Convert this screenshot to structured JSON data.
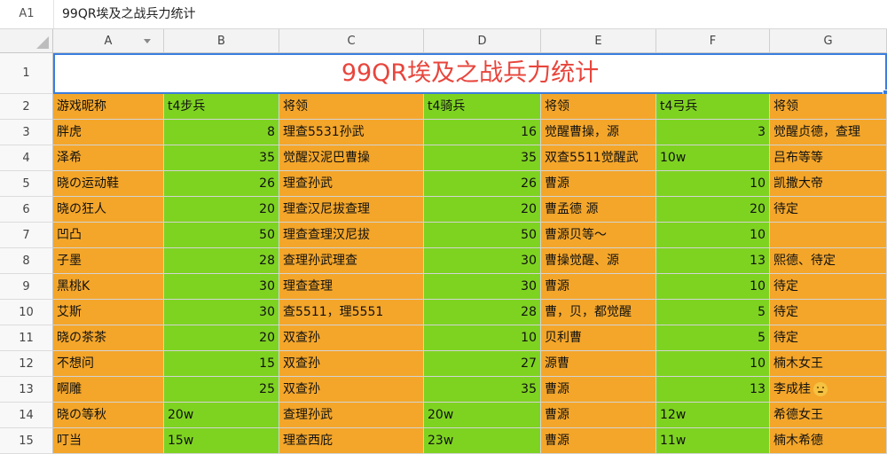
{
  "formula_bar": {
    "cell_ref": "A1",
    "content": "99QR埃及之战兵力统计"
  },
  "columns": [
    "A",
    "B",
    "C",
    "D",
    "E",
    "F",
    "G"
  ],
  "rows": [
    "1",
    "2",
    "3",
    "4",
    "5",
    "6",
    "7",
    "8",
    "9",
    "10",
    "11",
    "12",
    "13",
    "14",
    "15"
  ],
  "title": "99QR埃及之战兵力统计",
  "table": [
    [
      "游戏昵称",
      "t4步兵",
      "将领",
      "t4骑兵",
      "将领",
      "t4弓兵",
      "将领"
    ],
    [
      "胖虎",
      "8",
      "理查5531孙武",
      "16",
      "觉醒曹操，源",
      "3",
      "觉醒贞德，查理"
    ],
    [
      "泽希",
      "35",
      "觉醒汉泥巴曹操",
      "35",
      "双查5511觉醒武",
      "10w",
      "吕布等等"
    ],
    [
      "晓の运动鞋",
      "26",
      "理查孙武",
      "26",
      "曹源",
      "10",
      "凯撒大帝"
    ],
    [
      "晓の狂人",
      "20",
      "理查汉尼拔查理",
      "20",
      "曹孟德 源",
      "20",
      "待定"
    ],
    [
      "凹凸",
      "50",
      "理查查理汉尼拔",
      "50",
      "曹源贝等～",
      "10",
      ""
    ],
    [
      "子墨",
      "28",
      "查理孙武理查",
      "30",
      "曹操觉醒、源",
      "13",
      "熙德、待定"
    ],
    [
      "黑桃K",
      "30",
      "理查查理",
      "30",
      "曹源",
      "10",
      "待定"
    ],
    [
      "艾斯",
      "30",
      "查5511，理5551",
      "28",
      "曹，贝，都觉醒",
      "5",
      "待定"
    ],
    [
      "晓の茶茶",
      "20",
      "双查孙",
      "10",
      "贝利曹",
      "5",
      "待定"
    ],
    [
      "不想问",
      "15",
      "双查孙",
      "27",
      "源曹",
      "10",
      "楠木女王"
    ],
    [
      "啊雕",
      "25",
      "双查孙",
      "35",
      "曹源",
      "13",
      "李成桂"
    ],
    [
      "晓の等秋",
      "20w",
      "查理孙武",
      "20w",
      "曹源",
      "12w",
      "希德女王"
    ],
    [
      "叮当",
      "15w",
      "理查西庇",
      "23w",
      "曹源",
      "11w",
      "楠木希德"
    ]
  ],
  "numeric_columns": [
    1,
    3,
    5
  ],
  "colors": {
    "orange": "#f4a62a",
    "green": "#7ed321",
    "title": "#e8453c",
    "selection": "#3b7ddd"
  },
  "icons": {
    "row13_col6": "emoji-face-icon"
  }
}
